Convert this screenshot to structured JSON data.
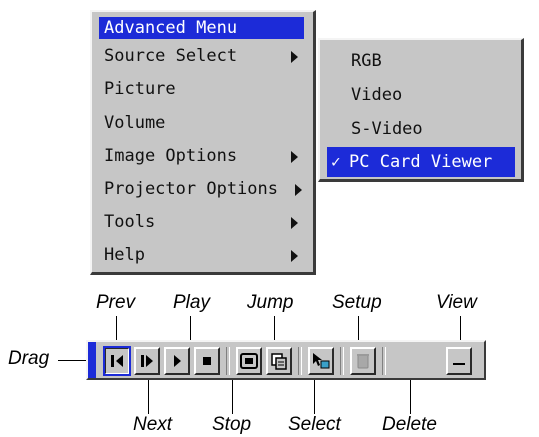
{
  "main_menu": {
    "title": "Advanced Menu",
    "items": [
      {
        "label": "Source Select",
        "has_submenu": true
      },
      {
        "label": "Picture",
        "has_submenu": false
      },
      {
        "label": "Volume",
        "has_submenu": false
      },
      {
        "label": "Image Options",
        "has_submenu": true
      },
      {
        "label": "Projector Options",
        "has_submenu": true
      },
      {
        "label": "Tools",
        "has_submenu": true
      },
      {
        "label": "Help",
        "has_submenu": true
      }
    ]
  },
  "submenu": {
    "items": [
      {
        "label": "RGB",
        "checked": false
      },
      {
        "label": "Video",
        "checked": false
      },
      {
        "label": "S-Video",
        "checked": false
      },
      {
        "label": "PC Card Viewer",
        "checked": true
      }
    ],
    "check_glyph": "✓"
  },
  "toolbar": {
    "labels": {
      "drag": "Drag",
      "prev": "Prev",
      "play": "Play",
      "jump": "Jump",
      "setup": "Setup",
      "view": "View",
      "next": "Next",
      "stop": "Stop",
      "select": "Select",
      "delete": "Delete"
    },
    "buttons": [
      {
        "name": "prev",
        "icon": "prev-icon"
      },
      {
        "name": "next",
        "icon": "next-icon"
      },
      {
        "name": "play",
        "icon": "play-icon"
      },
      {
        "name": "stop",
        "icon": "stop-icon"
      },
      {
        "name": "jump",
        "icon": "jump-icon"
      },
      {
        "name": "select",
        "icon": "select-icon"
      },
      {
        "name": "setup",
        "icon": "setup-icon"
      },
      {
        "name": "delete",
        "icon": "delete-icon",
        "disabled": true
      },
      {
        "name": "view",
        "icon": "view-icon"
      }
    ]
  },
  "colors": {
    "accent": "#1c2bd8",
    "menu_bg": "#c6c6c6"
  }
}
